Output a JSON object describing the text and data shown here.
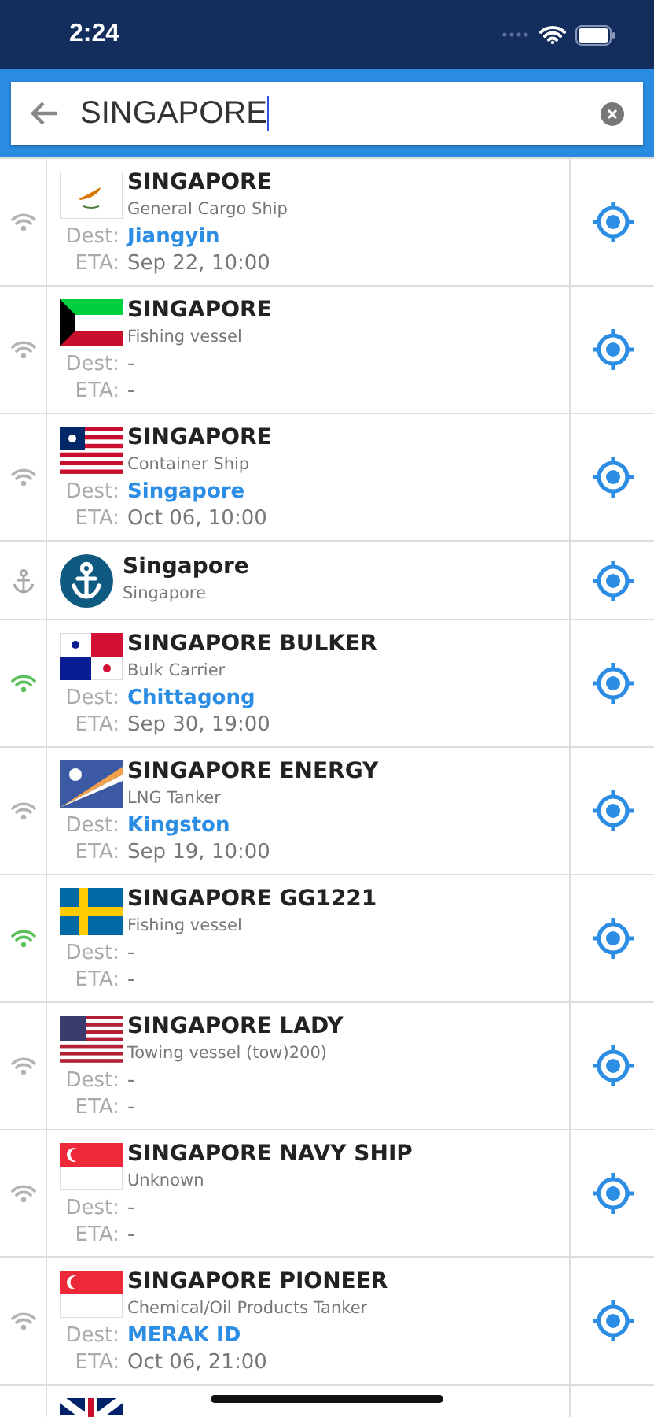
{
  "status_bar": {
    "time": "2:24"
  },
  "search": {
    "value": "SINGAPORE"
  },
  "results": [
    {
      "kind": "vessel",
      "online": false,
      "flag": {
        "kind": "cyprus"
      },
      "name": "SINGAPORE",
      "type": "General Cargo Ship",
      "dest_label": "Dest:",
      "dest": "Jiangyin",
      "dest_linked": true,
      "eta_label": "ETA:",
      "eta": "Sep 22, 10:00"
    },
    {
      "kind": "vessel",
      "online": false,
      "flag": {
        "kind": "kuwait"
      },
      "name": "SINGAPORE",
      "type": "Fishing vessel",
      "dest_label": "Dest:",
      "dest": "-",
      "dest_linked": false,
      "eta_label": "ETA:",
      "eta": "-"
    },
    {
      "kind": "vessel",
      "online": false,
      "flag": {
        "kind": "liberia"
      },
      "name": "SINGAPORE",
      "type": "Container Ship",
      "dest_label": "Dest:",
      "dest": "Singapore",
      "dest_linked": true,
      "eta_label": "ETA:",
      "eta": "Oct 06, 10:00"
    },
    {
      "kind": "port",
      "name": "Singapore",
      "type": "Singapore"
    },
    {
      "kind": "vessel",
      "online": true,
      "flag": {
        "kind": "panama"
      },
      "name": "SINGAPORE BULKER",
      "type": "Bulk Carrier",
      "dest_label": "Dest:",
      "dest": "Chittagong",
      "dest_linked": true,
      "eta_label": "ETA:",
      "eta": "Sep 30, 19:00"
    },
    {
      "kind": "vessel",
      "online": false,
      "flag": {
        "kind": "marshall"
      },
      "name": "SINGAPORE ENERGY",
      "type": "LNG Tanker",
      "dest_label": "Dest:",
      "dest": "Kingston",
      "dest_linked": true,
      "eta_label": "ETA:",
      "eta": "Sep 19, 10:00"
    },
    {
      "kind": "vessel",
      "online": true,
      "flag": {
        "kind": "sweden"
      },
      "name": "SINGAPORE GG1221",
      "type": "Fishing vessel",
      "dest_label": "Dest:",
      "dest": "-",
      "dest_linked": false,
      "eta_label": "ETA:",
      "eta": "-"
    },
    {
      "kind": "vessel",
      "online": false,
      "flag": {
        "kind": "usa"
      },
      "name": "SINGAPORE LADY",
      "type": "Towing vessel (tow)200)",
      "dest_label": "Dest:",
      "dest": "-",
      "dest_linked": false,
      "eta_label": "ETA:",
      "eta": "-"
    },
    {
      "kind": "vessel",
      "online": false,
      "flag": {
        "kind": "singapore"
      },
      "name": "SINGAPORE NAVY SHIP",
      "type": "Unknown",
      "dest_label": "Dest:",
      "dest": "-",
      "dest_linked": false,
      "eta_label": "ETA:",
      "eta": "-"
    },
    {
      "kind": "vessel",
      "online": false,
      "flag": {
        "kind": "singapore"
      },
      "name": "SINGAPORE PIONEER",
      "type": "Chemical/Oil Products Tanker",
      "dest_label": "Dest:",
      "dest": "MERAK ID",
      "dest_linked": true,
      "eta_label": "ETA:",
      "eta": "Oct 06, 21:00"
    },
    {
      "kind": "partial",
      "flag": {
        "kind": "uk"
      }
    }
  ]
}
